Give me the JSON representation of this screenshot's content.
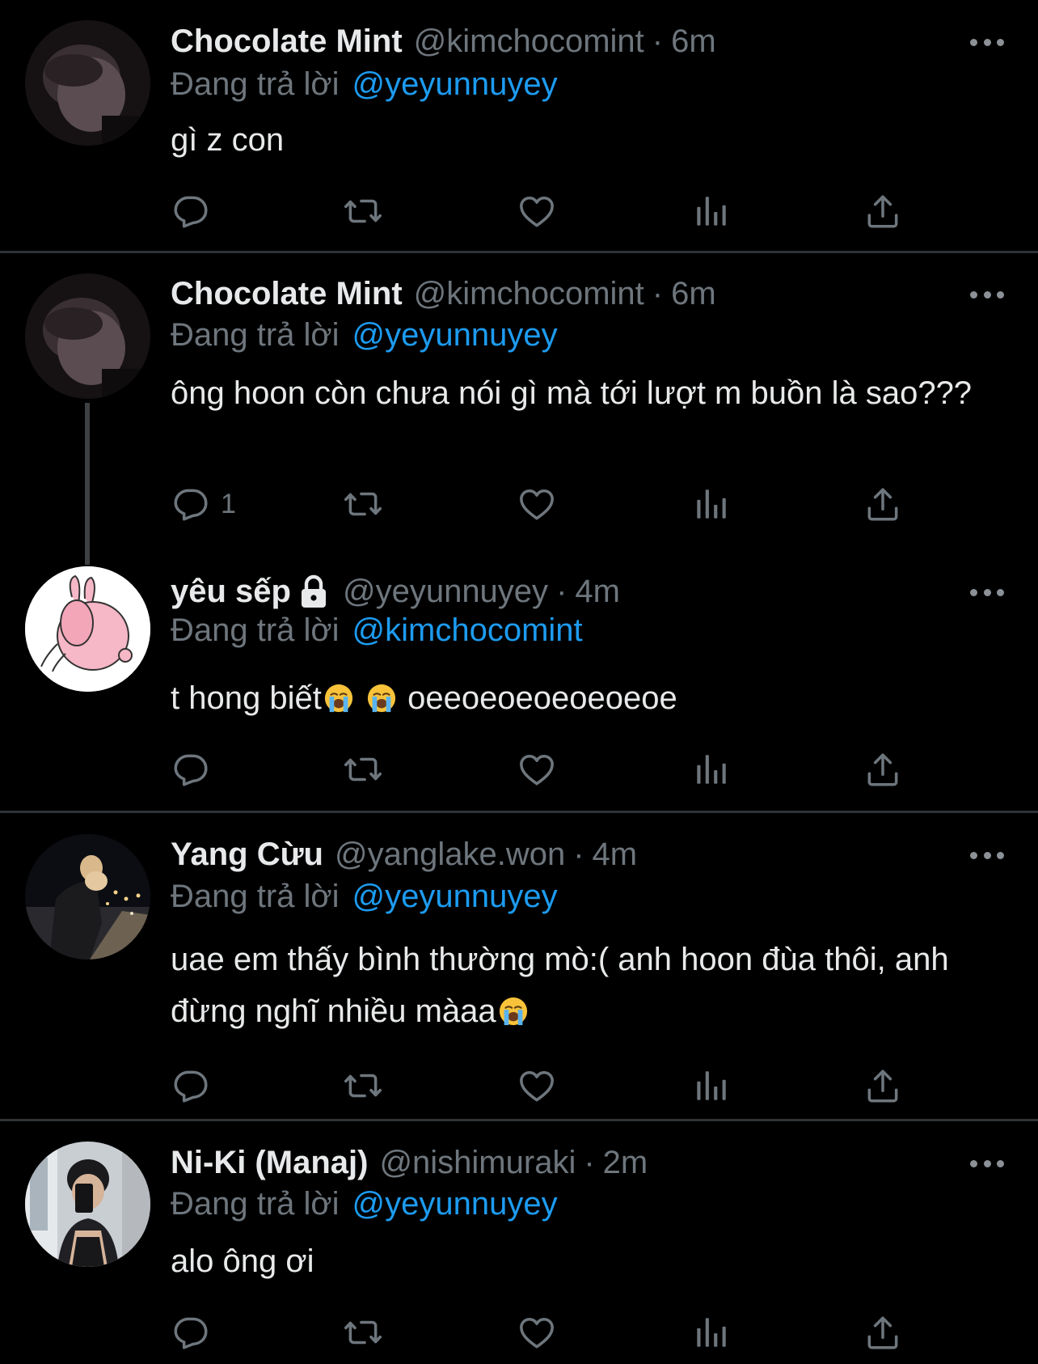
{
  "tweets": [
    {
      "name": "Chocolate Mint",
      "handle": "@kimchocomint",
      "dot": "·",
      "time": "6m",
      "replying_prefix": "Đang trả lời",
      "replying_to": "@yeyunnuyey",
      "text": "gì z con",
      "reply_count": "",
      "avatar": "dark-portrait-avatar"
    },
    {
      "name": "Chocolate Mint",
      "handle": "@kimchocomint",
      "dot": "·",
      "time": "6m",
      "replying_prefix": "Đang trả lời",
      "replying_to": "@yeyunnuyey",
      "text": "ông hoon còn chưa nói gì mà tới lượt m buồn là sao???",
      "reply_count": "1",
      "avatar": "dark-portrait-avatar"
    },
    {
      "name": "yêu sếp",
      "handle": "@yeyunnuyey",
      "dot": "·",
      "time": "4m",
      "replying_prefix": "Đang trả lời",
      "replying_to": "@kimchocomint",
      "text_before": "t hong biết",
      "text_after": "oeeoeoeoeoeoeoe",
      "protected_icon": "lock-icon",
      "reply_count": "",
      "avatar": "pink-bunny-avatar"
    },
    {
      "name": "Yang Cừu",
      "handle": "@yanglake.won",
      "dot": "·",
      "time": "4m",
      "replying_prefix": "Đang trả lời",
      "replying_to": "@yeyunnuyey",
      "text_before": "uae em thấy bình thường mò:( anh hoon đùa thôi, anh đừng nghĩ nhiều màaa",
      "reply_count": "",
      "avatar": "night-city-avatar"
    },
    {
      "name": "Ni-Ki (Manaj)",
      "handle": "@nishimuraki",
      "dot": "·",
      "time": "2m",
      "replying_prefix": "Đang trả lời",
      "replying_to": "@yeyunnuyey",
      "text": "alo ông ơi",
      "reply_count": "",
      "avatar": "mirror-selfie-avatar"
    }
  ],
  "icons": {
    "reply": "reply-icon",
    "retweet": "retweet-icon",
    "like": "heart-icon",
    "stats": "stats-icon",
    "share": "share-icon",
    "more": "more-icon",
    "emoji": "crying-face-emoji"
  },
  "colors": {
    "background": "#000000",
    "text": "#e7e9ea",
    "secondary": "#6e767d",
    "mention": "#1d9bf0",
    "divider": "#2f3336"
  }
}
